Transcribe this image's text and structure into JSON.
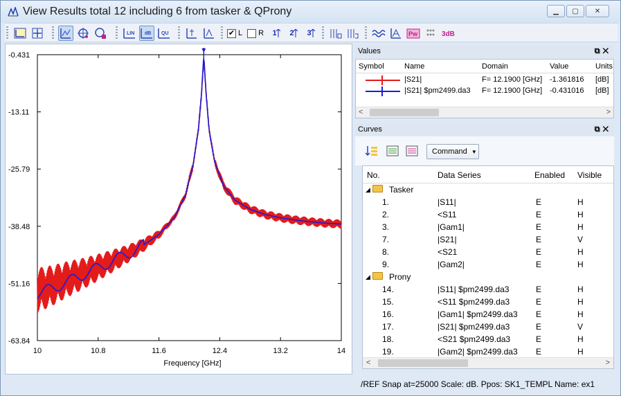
{
  "window": {
    "title": "View Results total 12 including 6 from tasker & QProny"
  },
  "toolbar": {
    "check_left_label": "L",
    "check_right_label": "R",
    "check_left_state": "✔",
    "check_right_state": "",
    "num_icons": [
      "1",
      "2",
      "3"
    ],
    "icons": [
      "s11-icon",
      "fit-icon",
      "xy-zoom-icon",
      "crosshair-icon",
      "marker-icon",
      "linear-scale-icon",
      "db-scale-icon",
      "qu-scale-icon",
      "table-icon",
      "table-def-icon",
      "wave-icon",
      "smith-icon",
      "pw-icon",
      "dots-icon",
      "3db-icon"
    ]
  },
  "chart_data": {
    "type": "line",
    "xlabel": "Frequency [GHz]",
    "xlim": [
      10,
      14
    ],
    "ylim": [
      -63.84,
      -0.431
    ],
    "x_ticks": [
      "10",
      "10.8",
      "11.6",
      "12.4",
      "13.2",
      "14"
    ],
    "y_ticks": [
      "-0.431",
      "-13.11",
      "-25.79",
      "-38.48",
      "-51.16",
      "-63.84"
    ],
    "marker_x": 12.19,
    "series": [
      {
        "name": "|S21|",
        "color": "#e31b1b",
        "x": [
          10.0,
          10.2,
          10.4,
          10.6,
          10.8,
          11.0,
          11.2,
          11.4,
          11.6,
          11.8,
          11.95,
          12.05,
          12.12,
          12.16,
          12.19,
          12.22,
          12.26,
          12.33,
          12.45,
          12.6,
          12.8,
          13.0,
          13.2,
          13.4,
          13.6,
          13.8,
          14.0
        ],
        "y": [
          -52.7,
          -51.6,
          -50.2,
          -49.0,
          -47.6,
          -46.1,
          -44.5,
          -42.6,
          -40.3,
          -36.6,
          -31.5,
          -24.8,
          -17.0,
          -9.0,
          -1.36,
          -9.0,
          -17.0,
          -24.0,
          -29.5,
          -32.7,
          -34.7,
          -35.9,
          -36.6,
          -37.1,
          -37.5,
          -37.8,
          -38.0
        ]
      },
      {
        "name": "|S21|  $pm2499.da3",
        "color": "#1c1cd6",
        "x": [
          10.0,
          10.2,
          10.4,
          10.6,
          10.8,
          11.0,
          11.2,
          11.4,
          11.6,
          11.8,
          11.95,
          12.05,
          12.12,
          12.16,
          12.19,
          12.22,
          12.26,
          12.33,
          12.45,
          12.6,
          12.8,
          13.0,
          13.2,
          13.4,
          13.6,
          13.8,
          14.0
        ],
        "y": [
          -53.5,
          -52.2,
          -50.8,
          -49.2,
          -47.7,
          -46.1,
          -44.5,
          -42.6,
          -40.3,
          -36.6,
          -31.5,
          -24.8,
          -17.0,
          -9.0,
          -0.431,
          -9.0,
          -17.0,
          -24.0,
          -29.5,
          -32.7,
          -34.7,
          -35.9,
          -36.6,
          -37.1,
          -37.5,
          -37.8,
          -38.0
        ]
      }
    ]
  },
  "values_panel": {
    "title": "Values",
    "columns": [
      "Symbol",
      "Name",
      "Domain",
      "Value",
      "Units"
    ],
    "rows": [
      {
        "name": "|S21|",
        "domain": "F= 12.1900 [GHz]",
        "value": "-1.361816",
        "units": "[dB]",
        "color": "#e31b1b"
      },
      {
        "name": "|S21|  $pm2499.da3",
        "domain": "F= 12.1900 [GHz]",
        "value": "-0.431016",
        "units": "[dB]",
        "color": "#1c1cd6"
      }
    ]
  },
  "curves_panel": {
    "title": "Curves",
    "command_label": "Command",
    "columns": [
      "No.",
      "Data Series",
      "Enabled",
      "Visible"
    ],
    "groups": [
      {
        "name": "Tasker",
        "rows": [
          {
            "no": "1.",
            "series": "|S11|",
            "enabled": "E",
            "visible": "H"
          },
          {
            "no": "2.",
            "series": "<S11",
            "enabled": "E",
            "visible": "H"
          },
          {
            "no": "3.",
            "series": "|Gam1|",
            "enabled": "E",
            "visible": "H"
          },
          {
            "no": "7.",
            "series": "|S21|",
            "enabled": "E",
            "visible": "V"
          },
          {
            "no": "8.",
            "series": "<S21",
            "enabled": "E",
            "visible": "H"
          },
          {
            "no": "9.",
            "series": "|Gam2|",
            "enabled": "E",
            "visible": "H"
          }
        ]
      },
      {
        "name": "Prony",
        "rows": [
          {
            "no": "14.",
            "series": "|S11|  $pm2499.da3",
            "enabled": "E",
            "visible": "H"
          },
          {
            "no": "15.",
            "series": "<S11  $pm2499.da3",
            "enabled": "E",
            "visible": "H"
          },
          {
            "no": "16.",
            "series": "|Gam1|  $pm2499.da3",
            "enabled": "E",
            "visible": "H"
          },
          {
            "no": "17.",
            "series": "|S21|  $pm2499.da3",
            "enabled": "E",
            "visible": "V"
          },
          {
            "no": "18.",
            "series": "<S21  $pm2499.da3",
            "enabled": "E",
            "visible": "H"
          },
          {
            "no": "19.",
            "series": "|Gam2|  $pm2499.da3",
            "enabled": "E",
            "visible": "H"
          }
        ]
      }
    ]
  },
  "status": {
    "text": "/REF  Snap at=25000    Scale: dB.  Ppos: SK1_TEMPL  Name: ex1"
  }
}
